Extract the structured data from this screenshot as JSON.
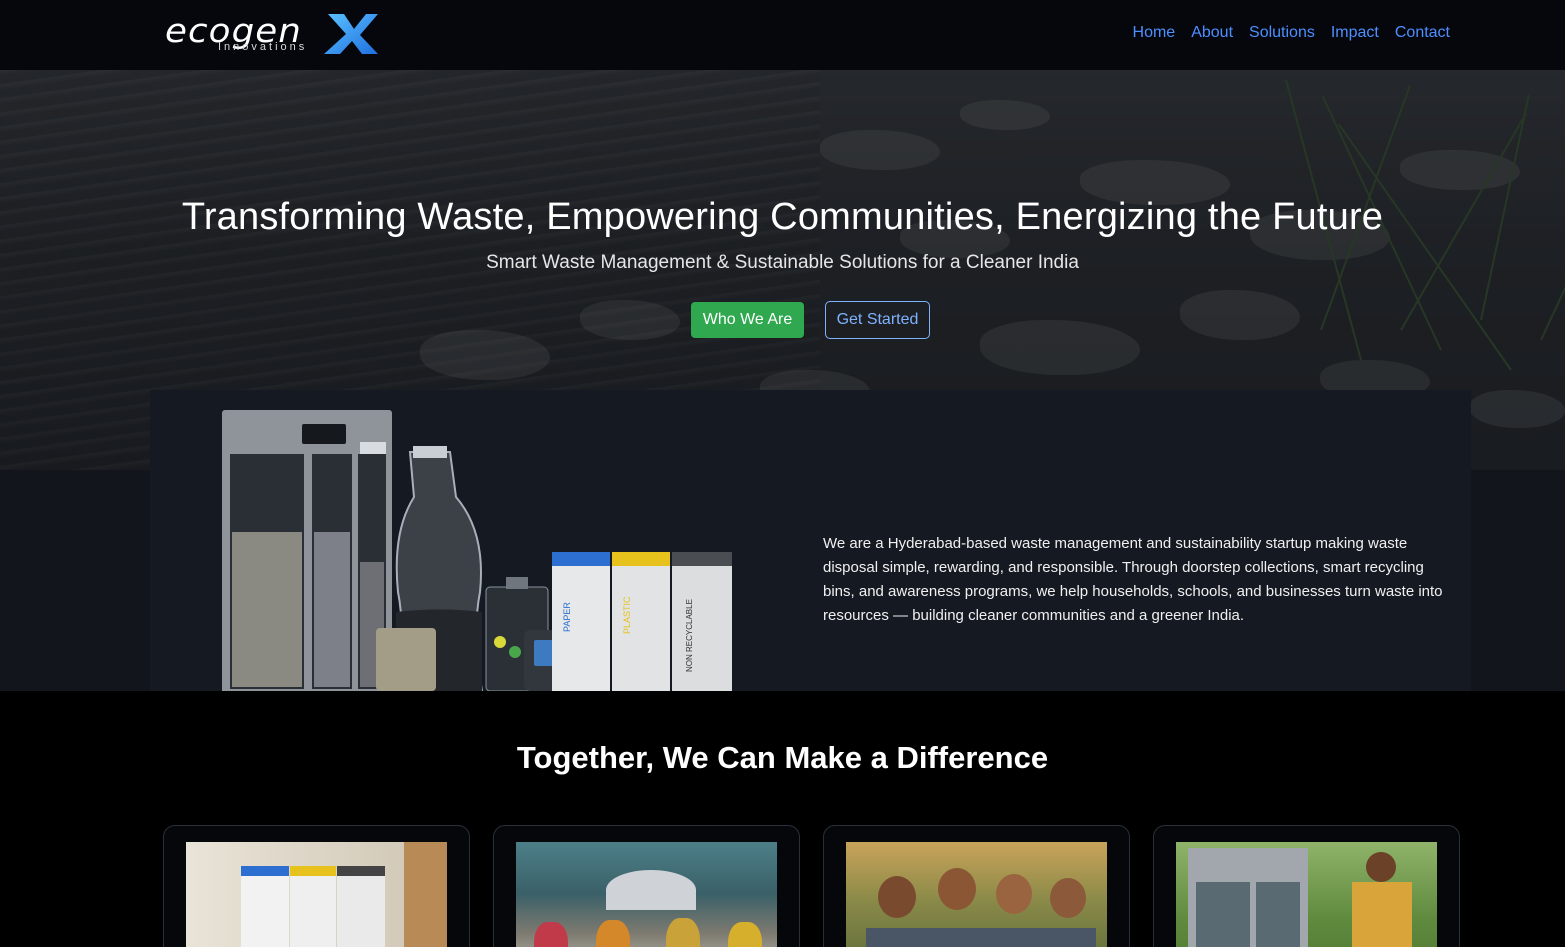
{
  "brand": {
    "name": "ecogen",
    "mark": "X",
    "tagline": "Innovations"
  },
  "nav": {
    "items": [
      "Home",
      "About",
      "Solutions",
      "Impact",
      "Contact"
    ]
  },
  "hero": {
    "title": "Transforming Waste, Empowering Communities, Energizing the Future",
    "subtitle": "Smart Waste Management & Sustainable Solutions for a Cleaner India",
    "primary_button": "Who We Are",
    "secondary_button": "Get Started"
  },
  "about": {
    "description": "We are a Hyderabad-based waste management and sustainability startup making waste disposal simple, rewarding, and responsible. Through doorstep collections, smart recycling bins, and awareness programs, we help households, schools, and businesses turn waste into resources — building cleaner communities and a greener India.",
    "bins": [
      "PAPER",
      "PLASTIC",
      "NON RECYCLABLE"
    ]
  },
  "difference": {
    "title": "Together, We Can Make a Difference"
  },
  "colors": {
    "accent": "#4d8fff",
    "primary_button": "#2fa84f",
    "bin_blue": "#2c6fd1",
    "bin_yellow": "#e8c21c"
  }
}
